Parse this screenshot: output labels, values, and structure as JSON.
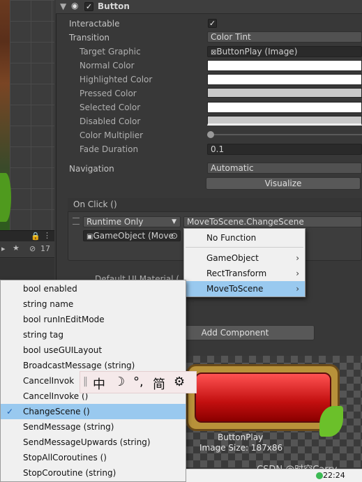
{
  "component": {
    "title": "Button"
  },
  "fields": {
    "interactable": "Interactable",
    "transition": "Transition",
    "transition_value": "Color Tint",
    "target_graphic": "Target Graphic",
    "target_graphic_value": "ButtonPlay (Image)",
    "normal_color": "Normal Color",
    "highlighted_color": "Highlighted Color",
    "pressed_color": "Pressed Color",
    "selected_color": "Selected Color",
    "disabled_color": "Disabled Color",
    "color_multiplier": "Color Multiplier",
    "fade_duration": "Fade Duration",
    "fade_duration_value": "0.1",
    "navigation": "Navigation",
    "navigation_value": "Automatic",
    "visualize": "Visualize"
  },
  "onclick": {
    "header": "On Click ()",
    "runtime": "Runtime Only",
    "function": "MoveToScene.ChangeScene",
    "target_object": "GameObject (Move"
  },
  "hierarchy": {
    "count": "17"
  },
  "material_row": "Default UI Material (",
  "add_component": "Add Component",
  "preview": {
    "name": "ButtonPlay",
    "size": "Image Size: 187x86"
  },
  "menu1": {
    "items": [
      {
        "label": "No Function",
        "arrow": ""
      },
      {
        "label": "GameObject",
        "arrow": "›"
      },
      {
        "label": "RectTransform",
        "arrow": "›"
      },
      {
        "label": "MoveToScene",
        "arrow": "›"
      }
    ]
  },
  "menu2": {
    "items": [
      "bool enabled",
      "string name",
      "bool runInEditMode",
      "string tag",
      "bool useGUILayout",
      "BroadcastMessage (string)",
      "CancelInvok",
      "CancelInvoke ()",
      "ChangeScene ()",
      "SendMessage (string)",
      "SendMessageUpwards (string)",
      "StopAllCoroutines ()",
      "StopCoroutine (string)"
    ]
  },
  "ime": {
    "chars": [
      "中",
      "☽",
      "°,",
      "简",
      "⚙"
    ]
  },
  "watermark": "CSDN @时空Carry",
  "taskbar": {
    "time": "22:24"
  },
  "colors": {
    "selected": "#99c9ef",
    "check": "#1a5db0"
  }
}
